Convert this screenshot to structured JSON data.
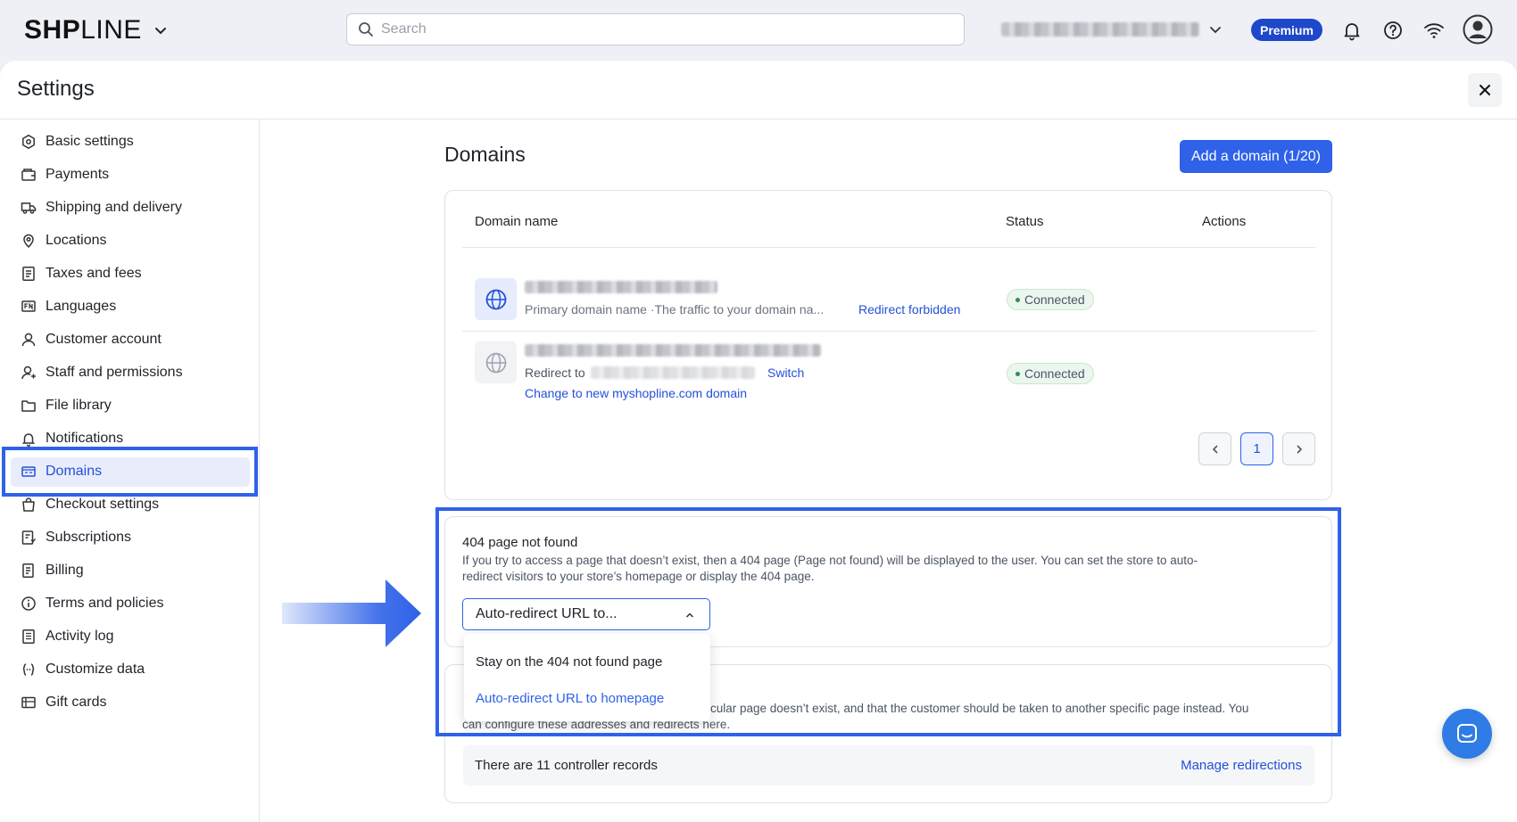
{
  "topbar": {
    "brand_bold": "SH",
    "brand_mid": "P",
    "brand_light": "LINE",
    "search_placeholder": "Search",
    "plan_badge": "Premium"
  },
  "panel": {
    "title": "Settings"
  },
  "sidebar": {
    "items": [
      {
        "label": "Basic settings",
        "icon": "settings-icon"
      },
      {
        "label": "Payments",
        "icon": "wallet-icon"
      },
      {
        "label": "Shipping and delivery",
        "icon": "truck-icon"
      },
      {
        "label": "Locations",
        "icon": "location-pin-icon"
      },
      {
        "label": "Taxes and fees",
        "icon": "receipt-icon"
      },
      {
        "label": "Languages",
        "icon": "language-icon"
      },
      {
        "label": "Customer account",
        "icon": "user-icon"
      },
      {
        "label": "Staff and permissions",
        "icon": "staff-icon"
      },
      {
        "label": "File library",
        "icon": "folder-icon"
      },
      {
        "label": "Notifications",
        "icon": "bell-icon"
      },
      {
        "label": "Domains",
        "icon": "domain-icon",
        "active": true
      },
      {
        "label": "Checkout settings",
        "icon": "bag-icon"
      },
      {
        "label": "Subscriptions",
        "icon": "subscription-icon"
      },
      {
        "label": "Billing",
        "icon": "bill-icon"
      },
      {
        "label": "Terms and policies",
        "icon": "info-icon"
      },
      {
        "label": "Activity log",
        "icon": "log-icon"
      },
      {
        "label": "Customize data",
        "icon": "code-braces-icon"
      },
      {
        "label": "Gift cards",
        "icon": "gift-card-icon"
      }
    ]
  },
  "domains": {
    "title": "Domains",
    "add_button": "Add a domain (1/20)",
    "columns": {
      "name": "Domain name",
      "status": "Status",
      "actions": "Actions"
    },
    "rows": [
      {
        "subtitle": "Primary domain name ·The traffic to your domain na...",
        "action_link": "Redirect forbidden",
        "status": "Connected"
      },
      {
        "redirect_label": "Redirect to",
        "switch_link": "Switch",
        "change_link": "Change to new myshopline.com domain",
        "status": "Connected"
      }
    ],
    "pagination": {
      "current_page": "1"
    }
  },
  "not_found": {
    "title": "404 page not found",
    "description_line1": "If you try to access a page that doesn’t exist, then a 404 page (Page not found) will be displayed to the user. You can set the store to auto-",
    "description_line2": "redirect visitors to your store’s homepage or display the 404 page.",
    "selected_value": "Auto-redirect URL to...",
    "options": [
      "Stay on the 404 not found page",
      "Auto-redirect URL to homepage"
    ]
  },
  "redirections": {
    "description_partial_line1": "cular page doesn’t exist, and that the customer should be taken to another specific page instead. You",
    "description_partial_line2": "can configure these addresses and redirects here.",
    "records_text": "There are 11 controller records",
    "manage_link": "Manage redirections"
  },
  "colors": {
    "accent": "#2f62e8",
    "link": "#2450d9",
    "premium": "#1d48c9",
    "connected_bg": "#eaf6ee"
  }
}
